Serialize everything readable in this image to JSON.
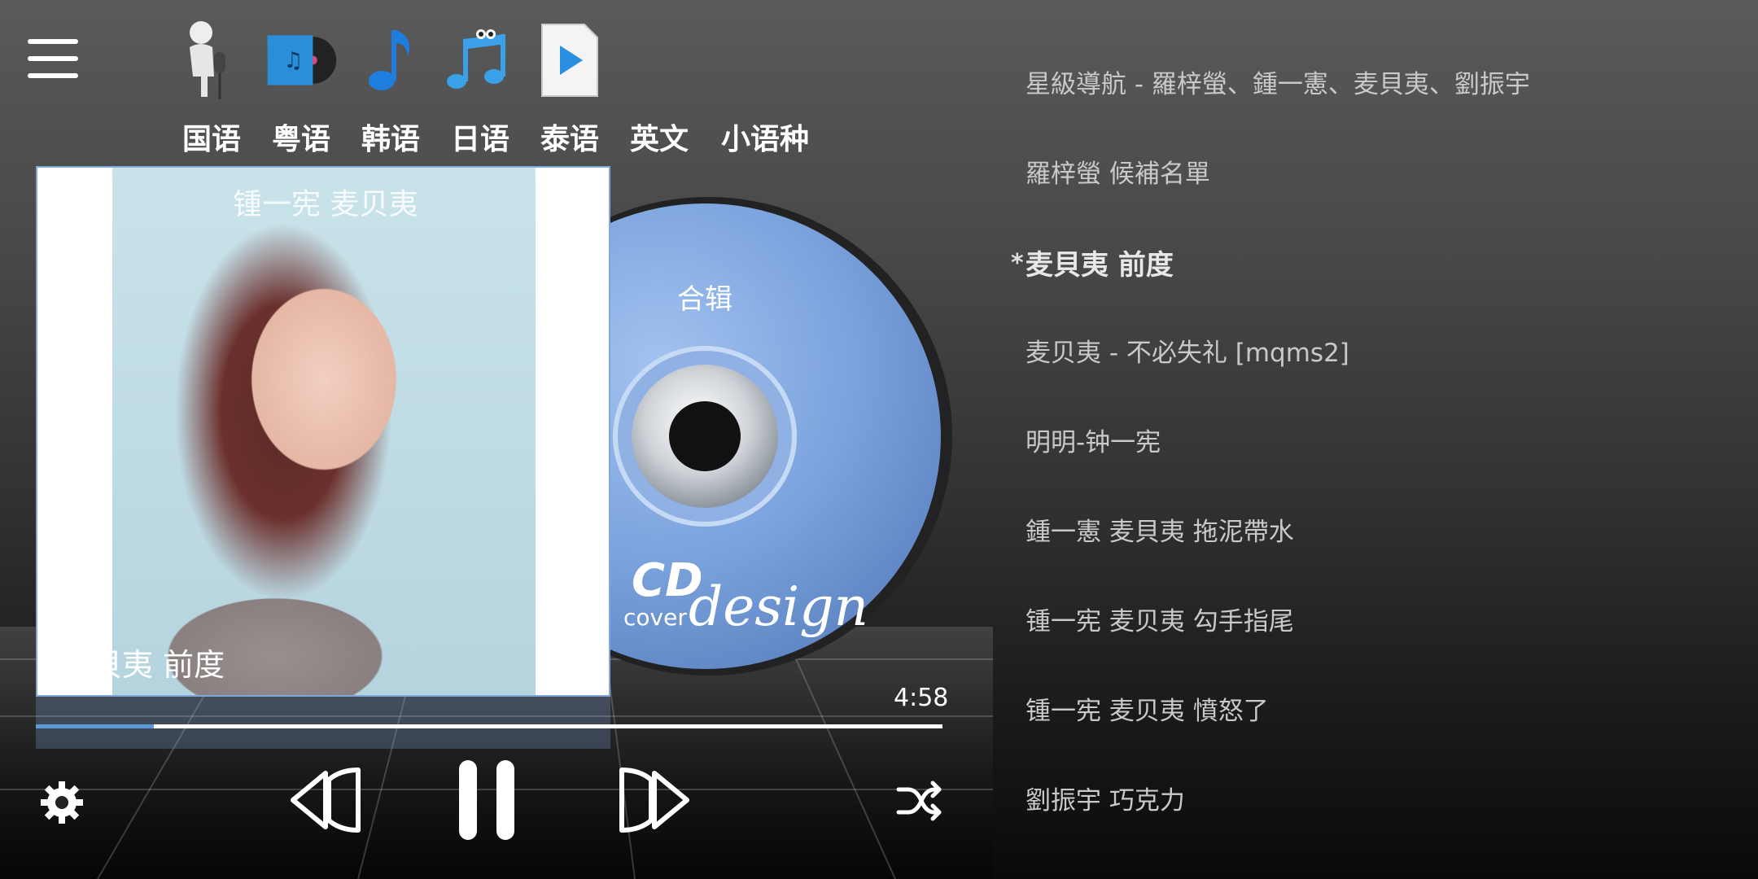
{
  "languages": [
    {
      "label": "国语",
      "icon": "microphone-person-icon"
    },
    {
      "label": "粤语",
      "icon": "music-album-icon"
    },
    {
      "label": "韩语",
      "icon": "music-note-icon"
    },
    {
      "label": "日语",
      "icon": "music-notes-cartoon-icon"
    },
    {
      "label": "泰语",
      "icon": "play-document-icon"
    },
    {
      "label": "英文",
      "icon": ""
    },
    {
      "label": "小语种",
      "icon": ""
    }
  ],
  "album": {
    "top_text": "锺一宪 麦贝夷",
    "bottom_text": "麦貝夷 前度",
    "cd_label": "合辑",
    "cd_brand": "CD",
    "cd_sub": "cover",
    "cd_script": "design"
  },
  "player": {
    "duration": "4:58",
    "progress_fraction": 0.13
  },
  "playlist": {
    "items": [
      "星級導航 - 羅梓螢、鍾一憲、麦貝夷、劉振宇",
      "羅梓螢 候補名單",
      "麦貝夷 前度",
      "麦贝夷 - 不必失礼 [mqms2]",
      "明明-钟一宪",
      "鍾一憲 麦貝夷 拖泥帶水",
      "锺一宪 麦贝夷 勾手指尾",
      "锺一宪 麦贝夷 憤怒了",
      "劉振宇 巧克力"
    ],
    "active_index": 2,
    "active_marker": "*"
  },
  "colors": {
    "accent": "#5a9bd6",
    "cd_blue": "#7ea5dd",
    "text": "#c9c9c9"
  }
}
